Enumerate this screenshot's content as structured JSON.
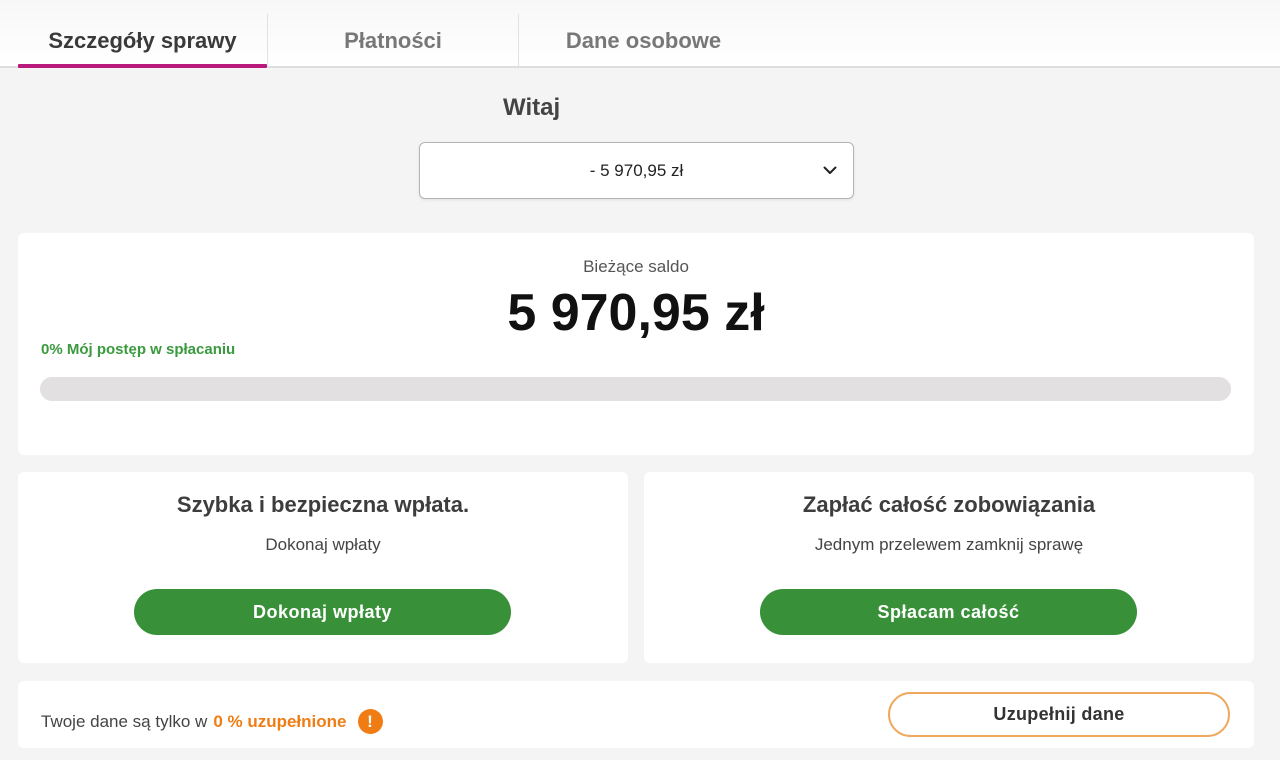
{
  "tabs": [
    {
      "label": "Szczegóły sprawy",
      "active": true
    },
    {
      "label": "Płatności",
      "active": false
    },
    {
      "label": "Dane osobowe",
      "active": false
    }
  ],
  "greeting": "Witaj",
  "case_select": {
    "selected": "- 5 970,95 zł",
    "icon": "chevron-down-icon"
  },
  "balance": {
    "label": "Bieżące saldo",
    "value": "5 970,95 zł",
    "progress_label": "0% Mój postęp w spłacaniu",
    "progress_percent": 0
  },
  "actions": [
    {
      "title": "Szybka i bezpieczna wpłata.",
      "subtitle": "Dokonaj wpłaty",
      "button": "Dokonaj wpłaty"
    },
    {
      "title": "Zapłać całość zobowiązania",
      "subtitle": "Jednym przelewem zamknij sprawę",
      "button": "Spłacam całość"
    }
  ],
  "data_completion": {
    "text": "Twoje dane są tylko w",
    "percent_text": "0 % uzupełnione",
    "warning_glyph": "!",
    "button": "Uzupełnij dane"
  },
  "colors": {
    "tab_accent": "#b8197a",
    "primary_green": "#389139",
    "warning_orange": "#ef7d14"
  }
}
